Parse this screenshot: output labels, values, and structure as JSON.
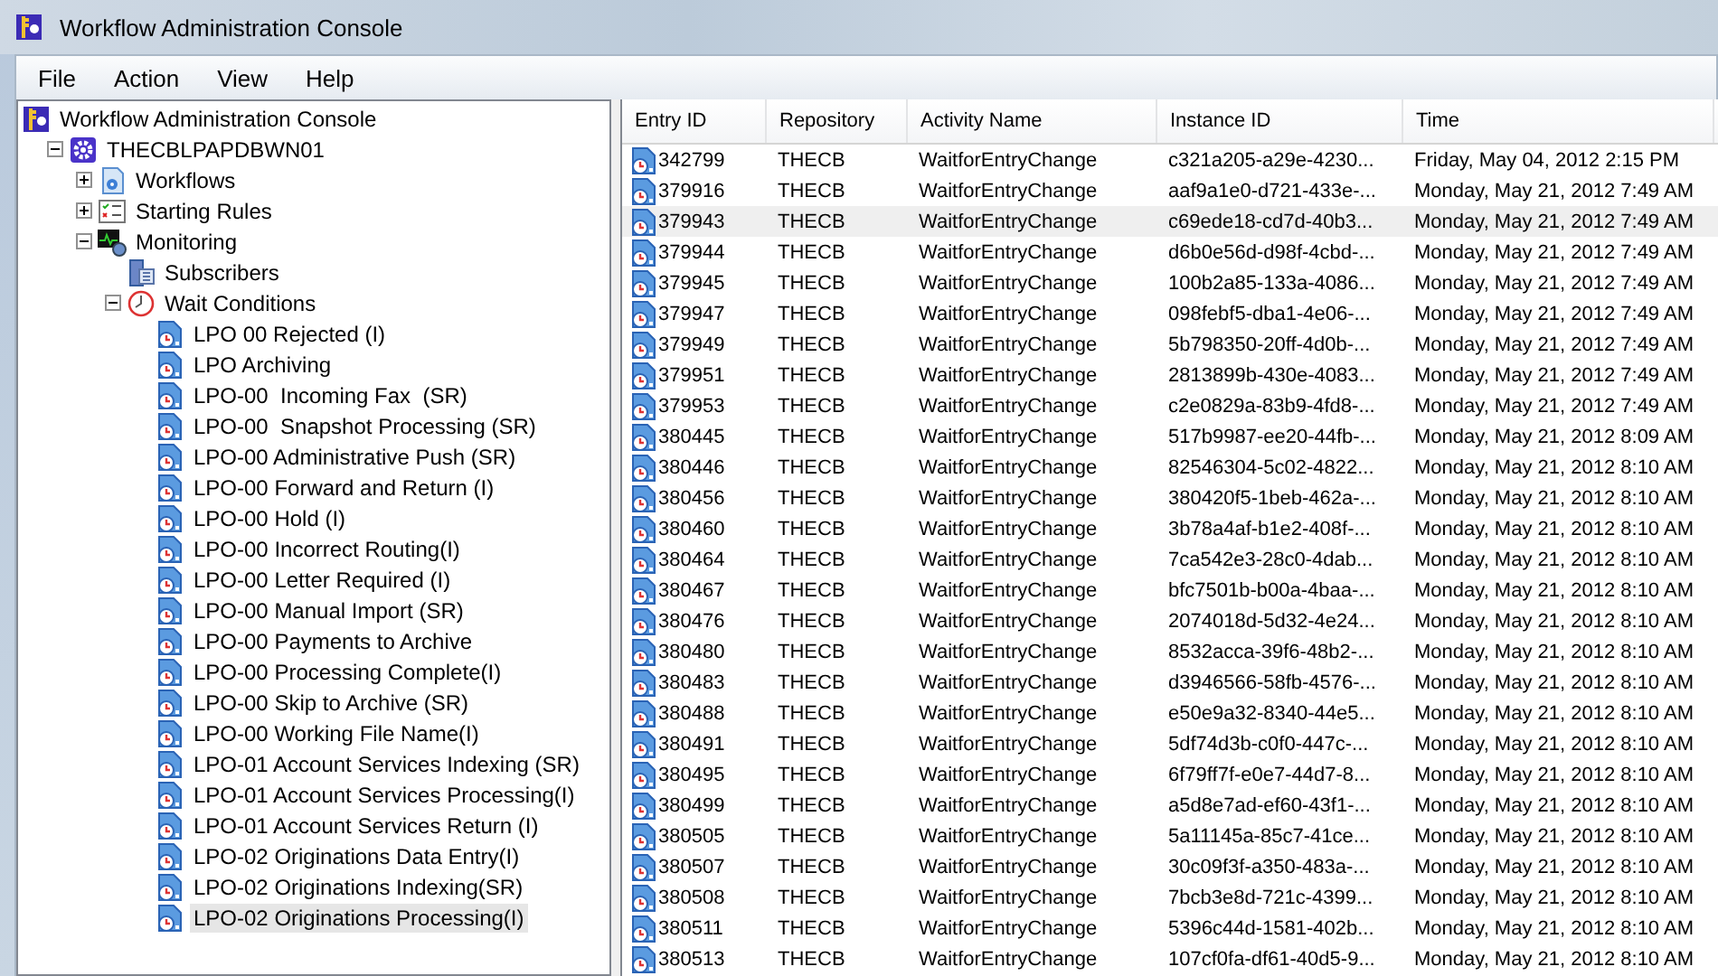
{
  "window": {
    "title": "Workflow Administration Console"
  },
  "menu": [
    "File",
    "Action",
    "View",
    "Help"
  ],
  "tree": [
    {
      "label": "Workflow Administration Console",
      "kind": "console",
      "selected": false,
      "children": [
        {
          "label": "THECBLPAPDBWN01",
          "kind": "server",
          "expanded": true,
          "selected": false,
          "children": [
            {
              "label": "Workflows",
              "kind": "workflows",
              "expanded": false,
              "selected": false
            },
            {
              "label": "Starting Rules",
              "kind": "rules",
              "expanded": false,
              "selected": false
            },
            {
              "label": "Monitoring",
              "kind": "monitoring",
              "expanded": true,
              "selected": false,
              "children": [
                {
                  "label": "Subscribers",
                  "kind": "subscribers",
                  "selected": false
                },
                {
                  "label": "Wait Conditions",
                  "kind": "wait",
                  "expanded": true,
                  "selected": false,
                  "children": [
                    {
                      "label": "LPO 00 Rejected (I)",
                      "kind": "condition",
                      "selected": false
                    },
                    {
                      "label": "LPO Archiving",
                      "kind": "condition",
                      "selected": false
                    },
                    {
                      "label": "LPO-00  Incoming Fax  (SR)",
                      "kind": "condition",
                      "selected": false
                    },
                    {
                      "label": "LPO-00  Snapshot Processing (SR)",
                      "kind": "condition",
                      "selected": false
                    },
                    {
                      "label": "LPO-00 Administrative Push (SR)",
                      "kind": "condition",
                      "selected": false
                    },
                    {
                      "label": "LPO-00 Forward and Return (I)",
                      "kind": "condition",
                      "selected": false
                    },
                    {
                      "label": "LPO-00 Hold (I)",
                      "kind": "condition",
                      "selected": false
                    },
                    {
                      "label": "LPO-00 Incorrect Routing(I)",
                      "kind": "condition",
                      "selected": false
                    },
                    {
                      "label": "LPO-00 Letter Required (I)",
                      "kind": "condition",
                      "selected": false
                    },
                    {
                      "label": "LPO-00 Manual Import (SR)",
                      "kind": "condition",
                      "selected": false
                    },
                    {
                      "label": "LPO-00 Payments to Archive",
                      "kind": "condition",
                      "selected": false
                    },
                    {
                      "label": "LPO-00 Processing Complete(I)",
                      "kind": "condition",
                      "selected": false
                    },
                    {
                      "label": "LPO-00 Skip to Archive (SR)",
                      "kind": "condition",
                      "selected": false
                    },
                    {
                      "label": "LPO-00 Working File Name(I)",
                      "kind": "condition",
                      "selected": false
                    },
                    {
                      "label": "LPO-01 Account Services Indexing (SR)",
                      "kind": "condition",
                      "selected": false
                    },
                    {
                      "label": "LPO-01 Account Services Processing(I)",
                      "kind": "condition",
                      "selected": false
                    },
                    {
                      "label": "LPO-01 Account Services Return (I)",
                      "kind": "condition",
                      "selected": false
                    },
                    {
                      "label": "LPO-02 Originations Data Entry(I)",
                      "kind": "condition",
                      "selected": false
                    },
                    {
                      "label": "LPO-02 Originations Indexing(SR)",
                      "kind": "condition",
                      "selected": false
                    },
                    {
                      "label": "LPO-02 Originations Processing(I)",
                      "kind": "condition",
                      "selected": true
                    }
                  ]
                }
              ]
            }
          ]
        }
      ]
    }
  ],
  "table": {
    "columns": [
      "Entry ID",
      "Repository",
      "Activity Name",
      "Instance ID",
      "Time"
    ],
    "rows": [
      {
        "cells": [
          "342799",
          "THECB",
          "WaitforEntryChange",
          "c321a205-a29e-4230...",
          "Friday, May 04, 2012 2:15 PM"
        ],
        "selected": false
      },
      {
        "cells": [
          "379916",
          "THECB",
          "WaitforEntryChange",
          "aaf9a1e0-d721-433e-...",
          "Monday, May 21, 2012 7:49 AM"
        ],
        "selected": false
      },
      {
        "cells": [
          "379943",
          "THECB",
          "WaitforEntryChange",
          "c69ede18-cd7d-40b3...",
          "Monday, May 21, 2012 7:49 AM"
        ],
        "selected": true
      },
      {
        "cells": [
          "379944",
          "THECB",
          "WaitforEntryChange",
          "d6b0e56d-d98f-4cbd-...",
          "Monday, May 21, 2012 7:49 AM"
        ],
        "selected": false
      },
      {
        "cells": [
          "379945",
          "THECB",
          "WaitforEntryChange",
          "100b2a85-133a-4086...",
          "Monday, May 21, 2012 7:49 AM"
        ],
        "selected": false
      },
      {
        "cells": [
          "379947",
          "THECB",
          "WaitforEntryChange",
          "098febf5-dba1-4e06-...",
          "Monday, May 21, 2012 7:49 AM"
        ],
        "selected": false
      },
      {
        "cells": [
          "379949",
          "THECB",
          "WaitforEntryChange",
          "5b798350-20ff-4d0b-...",
          "Monday, May 21, 2012 7:49 AM"
        ],
        "selected": false
      },
      {
        "cells": [
          "379951",
          "THECB",
          "WaitforEntryChange",
          "2813899b-430e-4083...",
          "Monday, May 21, 2012 7:49 AM"
        ],
        "selected": false
      },
      {
        "cells": [
          "379953",
          "THECB",
          "WaitforEntryChange",
          "c2e0829a-83b9-4fd8-...",
          "Monday, May 21, 2012 7:49 AM"
        ],
        "selected": false
      },
      {
        "cells": [
          "380445",
          "THECB",
          "WaitforEntryChange",
          "517b9987-ee20-44fb-...",
          "Monday, May 21, 2012 8:09 AM"
        ],
        "selected": false
      },
      {
        "cells": [
          "380446",
          "THECB",
          "WaitforEntryChange",
          "82546304-5c02-4822...",
          "Monday, May 21, 2012 8:10 AM"
        ],
        "selected": false
      },
      {
        "cells": [
          "380456",
          "THECB",
          "WaitforEntryChange",
          "380420f5-1beb-462a-...",
          "Monday, May 21, 2012 8:10 AM"
        ],
        "selected": false
      },
      {
        "cells": [
          "380460",
          "THECB",
          "WaitforEntryChange",
          "3b78a4af-b1e2-408f-...",
          "Monday, May 21, 2012 8:10 AM"
        ],
        "selected": false
      },
      {
        "cells": [
          "380464",
          "THECB",
          "WaitforEntryChange",
          "7ca542e3-28c0-4dab...",
          "Monday, May 21, 2012 8:10 AM"
        ],
        "selected": false
      },
      {
        "cells": [
          "380467",
          "THECB",
          "WaitforEntryChange",
          "bfc7501b-b00a-4baa-...",
          "Monday, May 21, 2012 8:10 AM"
        ],
        "selected": false
      },
      {
        "cells": [
          "380476",
          "THECB",
          "WaitforEntryChange",
          "2074018d-5d32-4e24...",
          "Monday, May 21, 2012 8:10 AM"
        ],
        "selected": false
      },
      {
        "cells": [
          "380480",
          "THECB",
          "WaitforEntryChange",
          "8532acca-39f6-48b2-...",
          "Monday, May 21, 2012 8:10 AM"
        ],
        "selected": false
      },
      {
        "cells": [
          "380483",
          "THECB",
          "WaitforEntryChange",
          "d3946566-58fb-4576-...",
          "Monday, May 21, 2012 8:10 AM"
        ],
        "selected": false
      },
      {
        "cells": [
          "380488",
          "THECB",
          "WaitforEntryChange",
          "e50e9a32-8340-44e5...",
          "Monday, May 21, 2012 8:10 AM"
        ],
        "selected": false
      },
      {
        "cells": [
          "380491",
          "THECB",
          "WaitforEntryChange",
          "5df74d3b-c0f0-447c-...",
          "Monday, May 21, 2012 8:10 AM"
        ],
        "selected": false
      },
      {
        "cells": [
          "380495",
          "THECB",
          "WaitforEntryChange",
          "6f79ff7f-e0e7-44d7-8...",
          "Monday, May 21, 2012 8:10 AM"
        ],
        "selected": false
      },
      {
        "cells": [
          "380499",
          "THECB",
          "WaitforEntryChange",
          "a5d8e7ad-ef60-43f1-...",
          "Monday, May 21, 2012 8:10 AM"
        ],
        "selected": false
      },
      {
        "cells": [
          "380505",
          "THECB",
          "WaitforEntryChange",
          "5a11145a-85c7-41ce...",
          "Monday, May 21, 2012 8:10 AM"
        ],
        "selected": false
      },
      {
        "cells": [
          "380507",
          "THECB",
          "WaitforEntryChange",
          "30c09f3f-a350-483a-...",
          "Monday, May 21, 2012 8:10 AM"
        ],
        "selected": false
      },
      {
        "cells": [
          "380508",
          "THECB",
          "WaitforEntryChange",
          "7bcb3e8d-721c-4399...",
          "Monday, May 21, 2012 8:10 AM"
        ],
        "selected": false
      },
      {
        "cells": [
          "380511",
          "THECB",
          "WaitforEntryChange",
          "5396c44d-1581-402b...",
          "Monday, May 21, 2012 8:10 AM"
        ],
        "selected": false
      },
      {
        "cells": [
          "380513",
          "THECB",
          "WaitforEntryChange",
          "107cf0fa-df61-40d5-9...",
          "Monday, May 21, 2012 8:10 AM"
        ],
        "selected": false
      }
    ]
  }
}
